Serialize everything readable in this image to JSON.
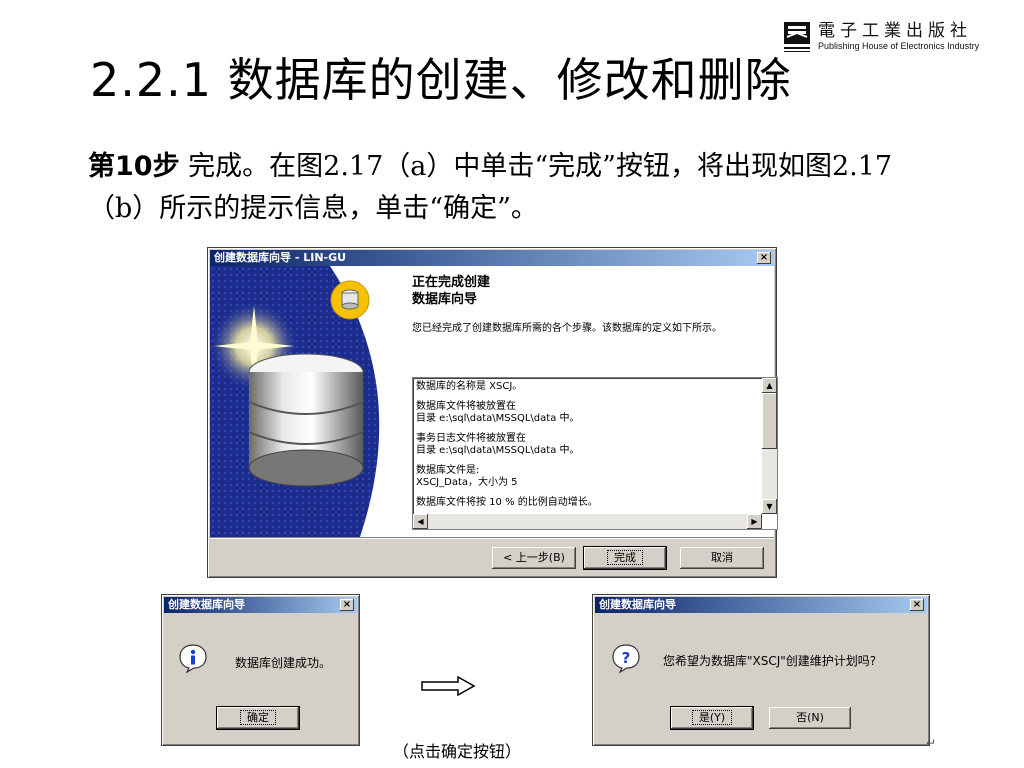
{
  "logo": {
    "cn": "電子工業出版社",
    "en": "Publishing House of Electronics Industry"
  },
  "title": "2.2.1  数据库的创建、修改和删除",
  "paragraph": {
    "step": "第10步",
    "text": " 完成。在图2.17（a）中单击“完成”按钮，将出现如图2.17（b）所示的提示信息，单击“确定”。"
  },
  "wizard": {
    "title": "创建数据库向导 - LIN-GU",
    "close": "×",
    "heading_line1": "正在完成创建",
    "heading_line2": "数据库向导",
    "description": "您已经完成了创建数据库所需的各个步骤。该数据库的定义如下所示。",
    "summary": [
      "数据库的名称是 XSCJ。",
      "数据库文件将被放置在",
      "目录 e:\\sql\\data\\MSSQL\\data 中。",
      "事务日志文件将被放置在",
      "目录 e:\\sql\\data\\MSSQL\\data 中。",
      "数据库文件是:",
      "XSCJ_Data，大小为 5",
      "数据库文件将按 10 % 的比例自动增长。"
    ],
    "back_label": "< 上一步(B)",
    "finish_label": "完成",
    "cancel_label": "取消"
  },
  "dialog_success": {
    "title": "创建数据库向导",
    "close": "×",
    "message": "数据库创建成功。",
    "ok_label": "确定",
    "icon": "info-icon"
  },
  "dialog_question": {
    "title": "创建数据库向导",
    "close": "×",
    "message": "您希望为数据库\"XSCJ\"创建维护计划吗?",
    "yes_label": "是(Y)",
    "no_label": "否(N)",
    "icon": "question-icon"
  },
  "caption": "（点击确定按钮）",
  "colors": {
    "titlebar_start": "#0a246a",
    "titlebar_end": "#a6caf0",
    "window_face": "#d4d0c8",
    "wizard_panel": "#1c2c8c"
  }
}
